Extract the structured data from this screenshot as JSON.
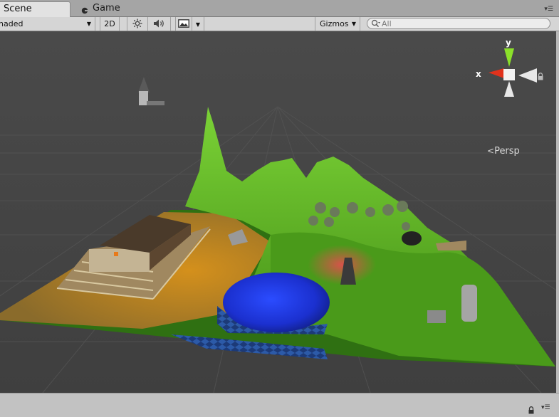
{
  "tabs": [
    {
      "label": "Scene",
      "icon": "scene-icon",
      "active": true
    },
    {
      "label": "Game",
      "icon": "game-icon",
      "active": false
    }
  ],
  "toolbar": {
    "shading_mode": "naded",
    "mode_2d": "2D",
    "lighting_icon": "sun-icon",
    "audio_icon": "speaker-icon",
    "effects_icon": "image-icon",
    "gizmos_label": "Gizmos",
    "search_placeholder": "All"
  },
  "orientation_gizmo": {
    "y_label": "y",
    "x_label": "x",
    "projection_label": "Persp"
  },
  "colors": {
    "viewport_bg": "#474747",
    "terrain_green": "#4f9a1e",
    "water_blue": "#1c34d6",
    "sand": "#b8861f",
    "axis_x": "#e0321c",
    "axis_y": "#8be02a"
  }
}
